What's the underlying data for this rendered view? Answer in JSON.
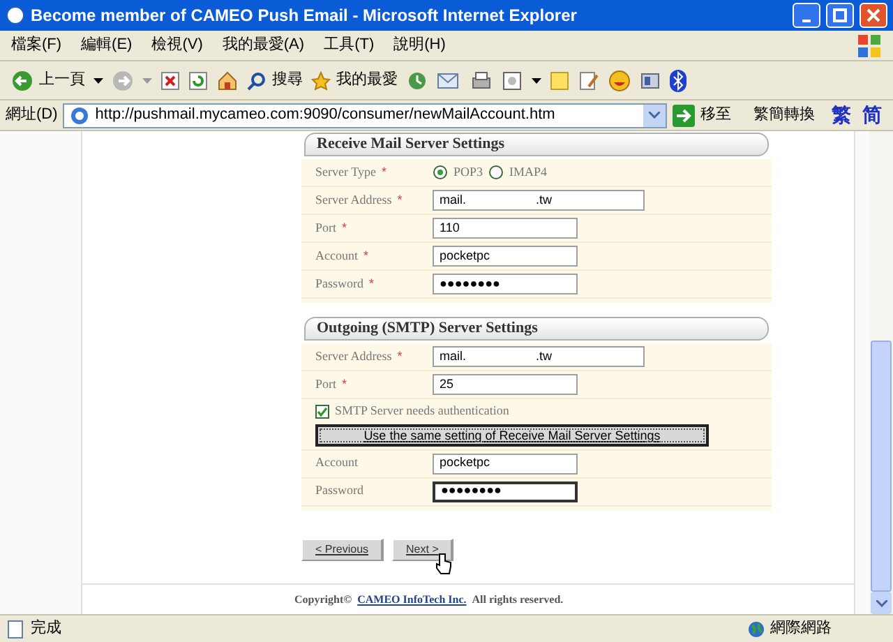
{
  "window": {
    "title": "Become member of CAMEO Push Email - Microsoft Internet Explorer"
  },
  "menu": [
    "檔案(F)",
    "編輯(E)",
    "檢視(V)",
    "我的最愛(A)",
    "工具(T)",
    "說明(H)"
  ],
  "toolbar": {
    "back": "上一頁",
    "search": "搜尋",
    "favorites": "我的最愛"
  },
  "address_bar": {
    "label": "網址(D)",
    "url": "http://pushmail.mycameo.com:9090/consumer/newMailAccount.htm",
    "go": "移至",
    "convert": "繁簡轉換",
    "traditional": "繁",
    "simplified": "简"
  },
  "sections": [
    {
      "title": "Receive Mail Server Settings",
      "rows": [
        {
          "kind": "radio",
          "label": "Server Type",
          "required_mark": "*",
          "options": [
            {
              "label": "POP3",
              "selected": true
            },
            {
              "label": "IMAP4",
              "selected": false
            }
          ]
        },
        {
          "kind": "text",
          "label": "Server Address",
          "required_mark": "*",
          "value": "mail.                    .tw",
          "wide": true
        },
        {
          "kind": "text",
          "label": "Port",
          "required_mark": "*",
          "value": "110",
          "wide": false
        },
        {
          "kind": "text",
          "label": "Account",
          "required_mark": "*",
          "value": "pocketpc",
          "wide": false
        },
        {
          "kind": "text",
          "label": "Password",
          "required_mark": "*",
          "value": "●●●●●●●●",
          "wide": false,
          "focused": false
        }
      ]
    },
    {
      "title": "Outgoing (SMTP) Server Settings",
      "rows": [
        {
          "kind": "text",
          "label": "Server Address",
          "required_mark": "*",
          "value": "mail.                    .tw",
          "wide": true
        },
        {
          "kind": "text",
          "label": "Port",
          "required_mark": "*",
          "value": "25",
          "wide": false
        },
        {
          "kind": "check",
          "label": "SMTP Server needs authentication",
          "checked": true,
          "button": "Use the same setting of Receive Mail Server Settings"
        },
        {
          "kind": "text",
          "label": "Account",
          "value": "pocketpc",
          "wide": false
        },
        {
          "kind": "text",
          "label": "Password",
          "value": "●●●●●●●●",
          "wide": false,
          "focused": true
        }
      ]
    }
  ],
  "nav_buttons": [
    "< Previous",
    "Next >"
  ],
  "footer": {
    "prefix": "Copyright©",
    "link": "CAMEO InfoTech Inc.",
    "suffix": "All rights reserved."
  },
  "status_bar": {
    "text": "完成",
    "zone": "網際網路"
  }
}
